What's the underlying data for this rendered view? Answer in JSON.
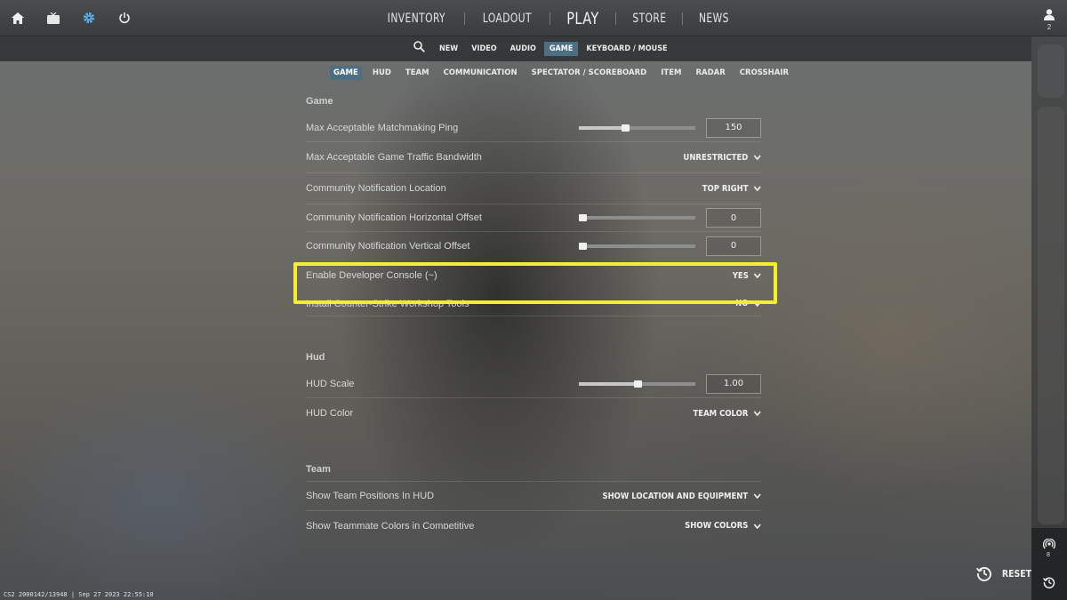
{
  "top_icons": [
    "home-icon",
    "tv-icon",
    "gear-icon",
    "power-icon"
  ],
  "main_nav": [
    {
      "label": "INVENTORY"
    },
    {
      "label": "LOADOUT"
    },
    {
      "label": "PLAY"
    },
    {
      "label": "STORE"
    },
    {
      "label": "NEWS"
    }
  ],
  "profile": {
    "count": "2"
  },
  "settings_tabs": [
    "NEW",
    "VIDEO",
    "AUDIO",
    "GAME",
    "KEYBOARD / MOUSE"
  ],
  "active_settings_tab": "GAME",
  "game_subtabs": [
    "GAME",
    "HUD",
    "TEAM",
    "COMMUNICATION",
    "SPECTATOR / SCOREBOARD",
    "ITEM",
    "RADAR",
    "CROSSHAIR"
  ],
  "active_game_subtab": "GAME",
  "sections": {
    "game": {
      "title": "Game",
      "rows": {
        "ping": {
          "label": "Max Acceptable Matchmaking Ping",
          "value": "150",
          "level": 0.4
        },
        "bandwidth": {
          "label": "Max Acceptable Game Traffic Bandwidth",
          "value": "UNRESTRICTED"
        },
        "notif_location": {
          "label": "Community Notification Location",
          "value": "TOP RIGHT"
        },
        "notif_h_offset": {
          "label": "Community Notification Horizontal Offset",
          "value": "0",
          "level": 0.0
        },
        "notif_v_offset": {
          "label": "Community Notification Vertical Offset",
          "value": "0",
          "level": 0.0
        },
        "dev_console": {
          "label": "Enable Developer Console (~)",
          "value": "YES"
        },
        "workshop_tools": {
          "label": "Install Counter-Strike Workshop Tools",
          "value": "NO"
        }
      }
    },
    "hud": {
      "title": "Hud",
      "rows": {
        "scale": {
          "label": "HUD Scale",
          "value": "1.00",
          "level": 0.5
        },
        "color": {
          "label": "HUD Color",
          "value": "TEAM COLOR"
        }
      }
    },
    "team": {
      "title": "Team",
      "rows": {
        "positions": {
          "label": "Show Team Positions In HUD",
          "value": "SHOW LOCATION AND EQUIPMENT"
        },
        "teammate_colors": {
          "label": "Show Teammate Colors in Competitive",
          "value": "SHOW COLORS"
        }
      }
    }
  },
  "reset_label": "RESET",
  "rail": {
    "count": "8"
  },
  "version_text": "CS2 2000142/13948 | Sep 27 2023 22:55:10",
  "colors": {
    "highlight": "#f3ef2a",
    "active_tab": "#4d6f84"
  }
}
